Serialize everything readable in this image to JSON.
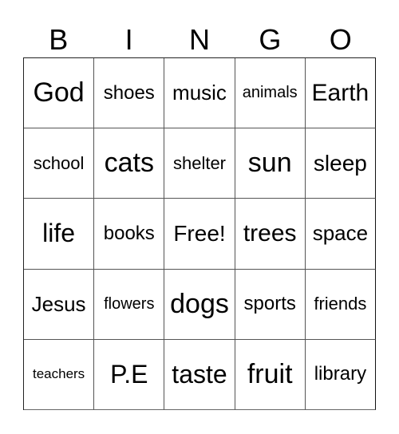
{
  "header": {
    "letters": [
      "B",
      "I",
      "N",
      "G",
      "O"
    ]
  },
  "card": {
    "rows": [
      [
        "God",
        "shoes",
        "music",
        "animals",
        "Earth"
      ],
      [
        "school",
        "cats",
        "shelter",
        "sun",
        "sleep"
      ],
      [
        "life",
        "books",
        "Free!",
        "trees",
        "space"
      ],
      [
        "Jesus",
        "flowers",
        "dogs",
        "sports",
        "friends"
      ],
      [
        "teachers",
        "P.E",
        "taste",
        "fruit",
        "library"
      ]
    ],
    "free_space": "Free!"
  }
}
